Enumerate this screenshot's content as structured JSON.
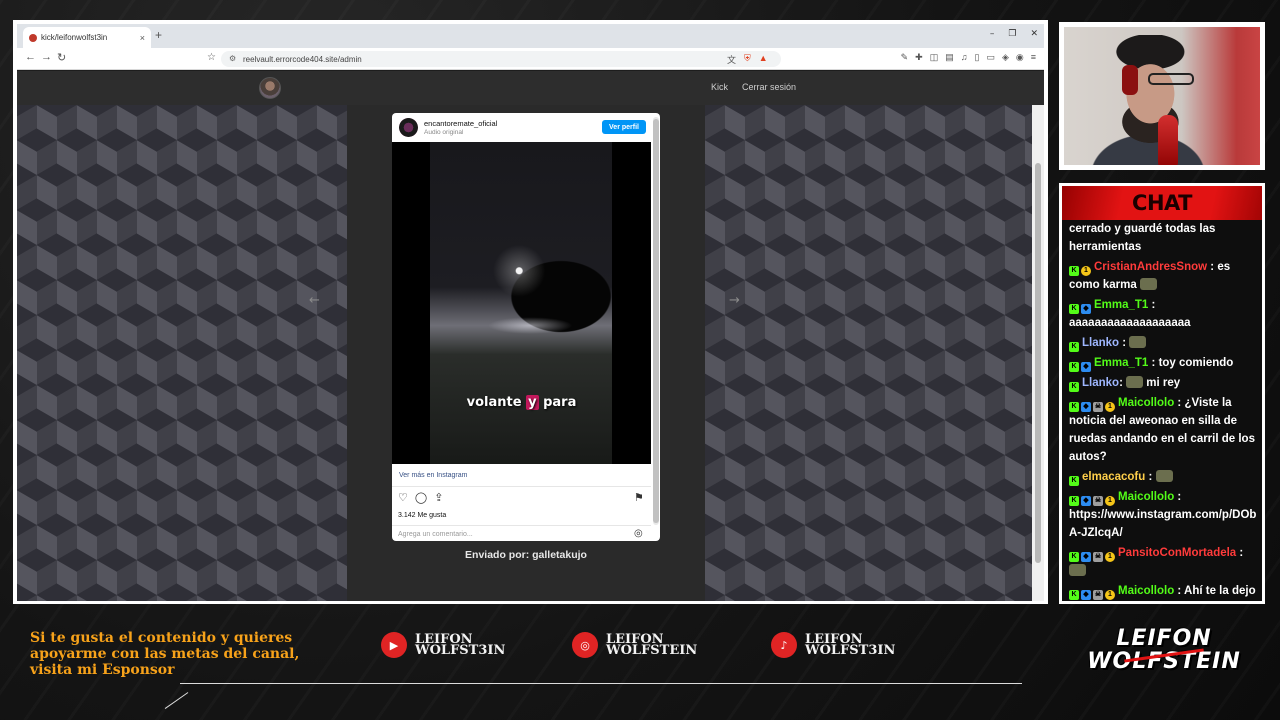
{
  "browser": {
    "tab_title": "kick/leifonwolfst3in",
    "tab_close": "×",
    "new_tab": "+",
    "window_controls": [
      "–",
      "❐",
      "✕"
    ],
    "url": "reelvault.errorcode404.site/admin"
  },
  "site": {
    "nav_links": [
      "Kick",
      "Cerrar sesión"
    ],
    "prev_arrow": "←",
    "next_arrow": "→",
    "sent_by": "Enviado por: galletakujo"
  },
  "instagram": {
    "username": "encantoremate_oficial",
    "audio": "Audio original",
    "follow_button": "Ver perfil",
    "caption_before": "volante ",
    "caption_highlight": "y",
    "caption_after": " para",
    "view_more": "Ver más en Instagram",
    "likes": "3.142 Me gusta",
    "comment_placeholder": "Agrega un comentario..."
  },
  "chat": {
    "title": "CHAT",
    "messages": [
      {
        "user": "",
        "badges": [],
        "text": "cerrado y guardé todas las herramientas"
      },
      {
        "user": "CristianAndresSnow",
        "color": "red",
        "badges": [
          "k",
          "og"
        ],
        "text": ": es como karma",
        "emote": true
      },
      {
        "user": "Emma_T1",
        "color": "green",
        "badges": [
          "k",
          "vip"
        ],
        "text": ": aaaaaaaaaaaaaaaaaaa"
      },
      {
        "user": "Llanko",
        "color": "blue",
        "badges": [
          "k"
        ],
        "text": ":",
        "emote": true
      },
      {
        "user": "Emma_T1",
        "color": "green",
        "badges": [
          "k",
          "vip"
        ],
        "text": ": toy comiendo"
      },
      {
        "user": "Llanko",
        "color": "blue",
        "badges": [
          "k"
        ],
        "text": ": mi rey",
        "emote_before": true
      },
      {
        "user": "Maicollolo",
        "color": "green",
        "badges": [
          "k",
          "vip",
          "sub",
          "og"
        ],
        "text": ": ¿Viste la noticia del aweonao en silla de ruedas andando en el carril de los autos?"
      },
      {
        "user": "elmacacofu",
        "color": "yellow",
        "badges": [
          "k"
        ],
        "text": ":",
        "emote": true
      },
      {
        "user": "Maicollolo",
        "color": "green",
        "badges": [
          "k",
          "vip",
          "sub",
          "og"
        ],
        "text": ": https://www.instagram.com/p/DObA-JZlcqA/"
      },
      {
        "user": "PansitoConMortadela",
        "color": "red",
        "badges": [
          "k",
          "vip",
          "sub",
          "og"
        ],
        "text": ":",
        "emote": true
      },
      {
        "user": "Maicollolo",
        "color": "green",
        "badges": [
          "k",
          "vip",
          "sub",
          "og"
        ],
        "text": ": Ahí te la dejo"
      }
    ]
  },
  "overlay": {
    "sponsor_text": "Si te gusta el contenido y quieres apoyarme con las metas del canal, visita mi Esponsor",
    "socials": [
      {
        "platform": "youtube",
        "icon": "▶",
        "line1": "LEIFON",
        "line2": "WOLFST3IN"
      },
      {
        "platform": "instagram",
        "icon": "◎",
        "line1": "LEIFON",
        "line2": "WOLFSTEIN"
      },
      {
        "platform": "tiktok",
        "icon": "♪",
        "line1": "LEIFON",
        "line2": "WOLFST3IN"
      }
    ],
    "logo_line1": "LEIFON",
    "logo_line2": "WOLFSTEIN"
  },
  "colors": {
    "accent_red": "#e21313",
    "sponsor_orange": "#f7a21a",
    "kick_green": "#53fc18",
    "instagram_blue": "#0095f6"
  }
}
